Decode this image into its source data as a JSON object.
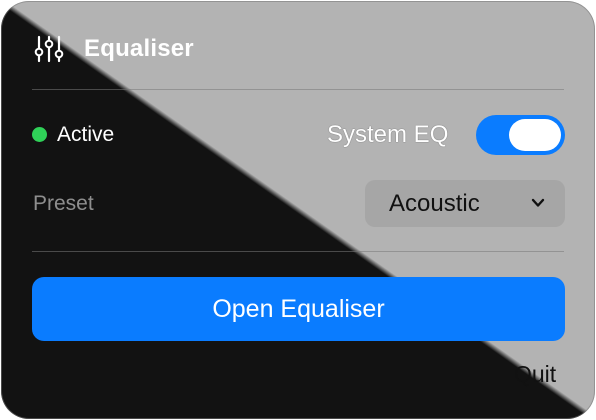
{
  "header": {
    "icon": "sliders-icon",
    "title": "Equaliser"
  },
  "status": {
    "label": "Active",
    "color": "#2fd158"
  },
  "system_eq": {
    "label": "System EQ",
    "enabled": true,
    "accent": "#0a7cff"
  },
  "preset": {
    "label": "Preset",
    "value": "Acoustic",
    "icon": "chevron-down-icon"
  },
  "actions": {
    "open_label": "Open Equaliser",
    "quit_label": "Quit"
  }
}
